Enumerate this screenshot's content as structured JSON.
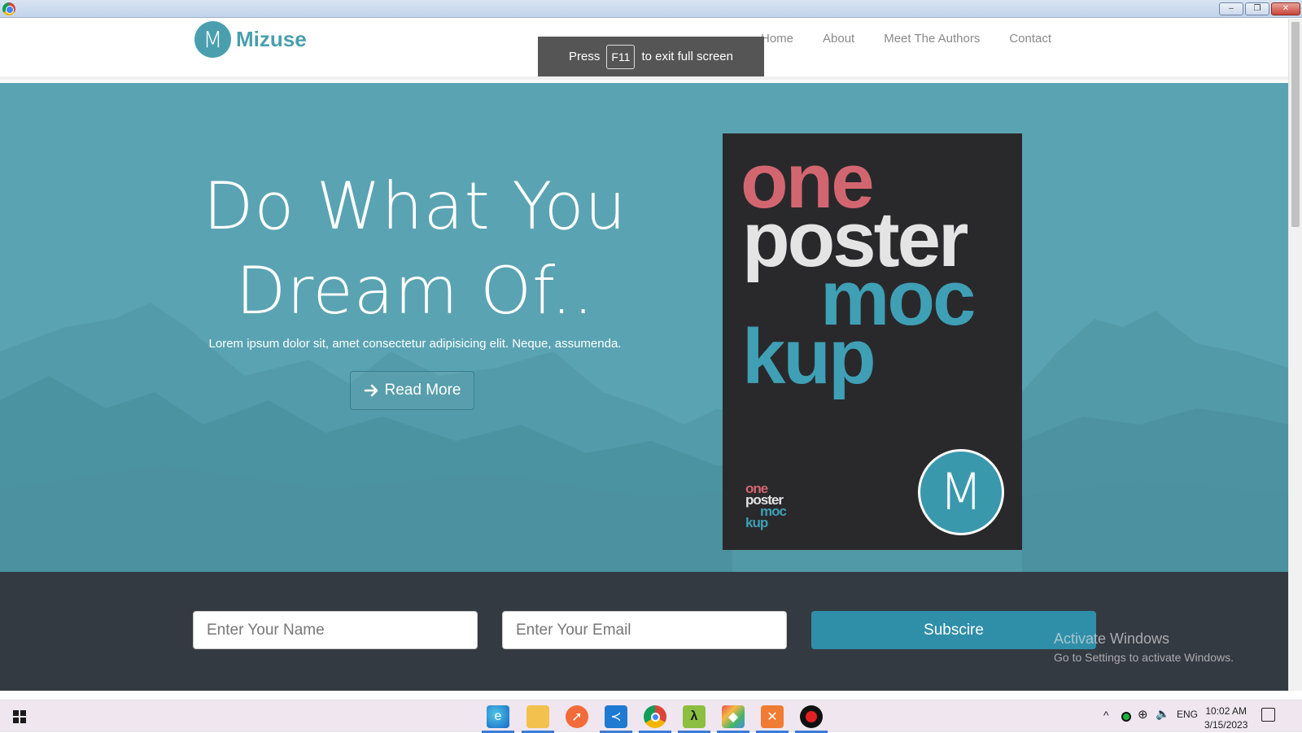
{
  "window": {
    "minimize": "–",
    "maximize": "❐",
    "close": "✕"
  },
  "brand": {
    "logo_letter": "M",
    "name": "Mizuse"
  },
  "nav": {
    "items": [
      {
        "label": "Home"
      },
      {
        "label": "About"
      },
      {
        "label": "Meet The Authors"
      },
      {
        "label": "Contact"
      }
    ]
  },
  "fullscreen_toast": {
    "before": "Press",
    "key": "F11",
    "after": "to exit full screen"
  },
  "hero": {
    "title_line1": "Do What You",
    "title_line2": "Dream Of..",
    "subtitle": "Lorem ipsum dolor sit, amet consectetur adipisicing elit. Neque, assumenda.",
    "cta_icon": "arrow-right-icon",
    "cta_label": "Read More"
  },
  "poster": {
    "line1": "one",
    "line2": "poster",
    "line3": "moc",
    "line4": "kup",
    "small": [
      "one",
      "poster",
      "moc",
      "kup"
    ],
    "logo_letter": "M",
    "colors": {
      "bg": "#29292b",
      "pink": "#d26670",
      "light": "#e4e4e4",
      "teal": "#3f9fb5"
    }
  },
  "subscribe": {
    "name_placeholder": "Enter Your Name",
    "email_placeholder": "Enter Your Email",
    "button_label": "Subscire"
  },
  "watermark": {
    "line1": "Activate Windows",
    "line2": "Go to Settings to activate Windows."
  },
  "taskbar": {
    "apps": [
      "edge-icon",
      "file-explorer-icon",
      "postman-icon",
      "vscode-icon",
      "chrome-icon",
      "lambda-icon",
      "git-icon",
      "xampp-icon",
      "recorder-icon"
    ],
    "tray": {
      "chevron": "^",
      "lang": "ENG"
    },
    "time": "10:02 AM",
    "date": "3/15/2023"
  },
  "colors": {
    "accent": "#4a9fae",
    "hero_bg": "#5aa3b2",
    "band": "#343a42",
    "button": "#2f8fa9"
  }
}
